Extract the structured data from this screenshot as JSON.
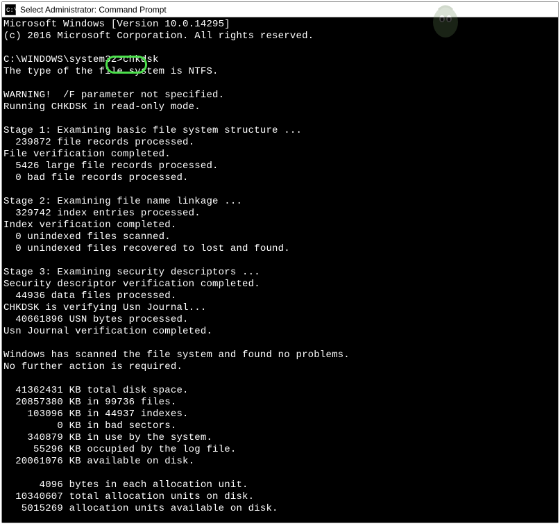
{
  "titlebar": {
    "title": "Select Administrator: Command Prompt"
  },
  "terminal": {
    "lines": [
      "Microsoft Windows [Version 10.0.14295]",
      "(c) 2016 Microsoft Corporation. All rights reserved.",
      "",
      "C:\\WINDOWS\\system32>chkdsk",
      "The type of the file system is NTFS.",
      "",
      "WARNING!  /F parameter not specified.",
      "Running CHKDSK in read-only mode.",
      "",
      "Stage 1: Examining basic file system structure ...",
      "  239872 file records processed.",
      "File verification completed.",
      "  5426 large file records processed.",
      "  0 bad file records processed.",
      "",
      "Stage 2: Examining file name linkage ...",
      "  329742 index entries processed.",
      "Index verification completed.",
      "  0 unindexed files scanned.",
      "  0 unindexed files recovered to lost and found.",
      "",
      "Stage 3: Examining security descriptors ...",
      "Security descriptor verification completed.",
      "  44936 data files processed.",
      "CHKDSK is verifying Usn Journal...",
      "  40661896 USN bytes processed.",
      "Usn Journal verification completed.",
      "",
      "Windows has scanned the file system and found no problems.",
      "No further action is required.",
      "",
      "  41362431 KB total disk space.",
      "  20857380 KB in 99736 files.",
      "    103096 KB in 44937 indexes.",
      "         0 KB in bad sectors.",
      "    340879 KB in use by the system.",
      "     55296 KB occupied by the log file.",
      "  20061076 KB available on disk.",
      "",
      "      4096 bytes in each allocation unit.",
      "  10340607 total allocation units on disk.",
      "   5015269 allocation units available on disk."
    ]
  },
  "highlight": {
    "target": "chkdsk"
  }
}
